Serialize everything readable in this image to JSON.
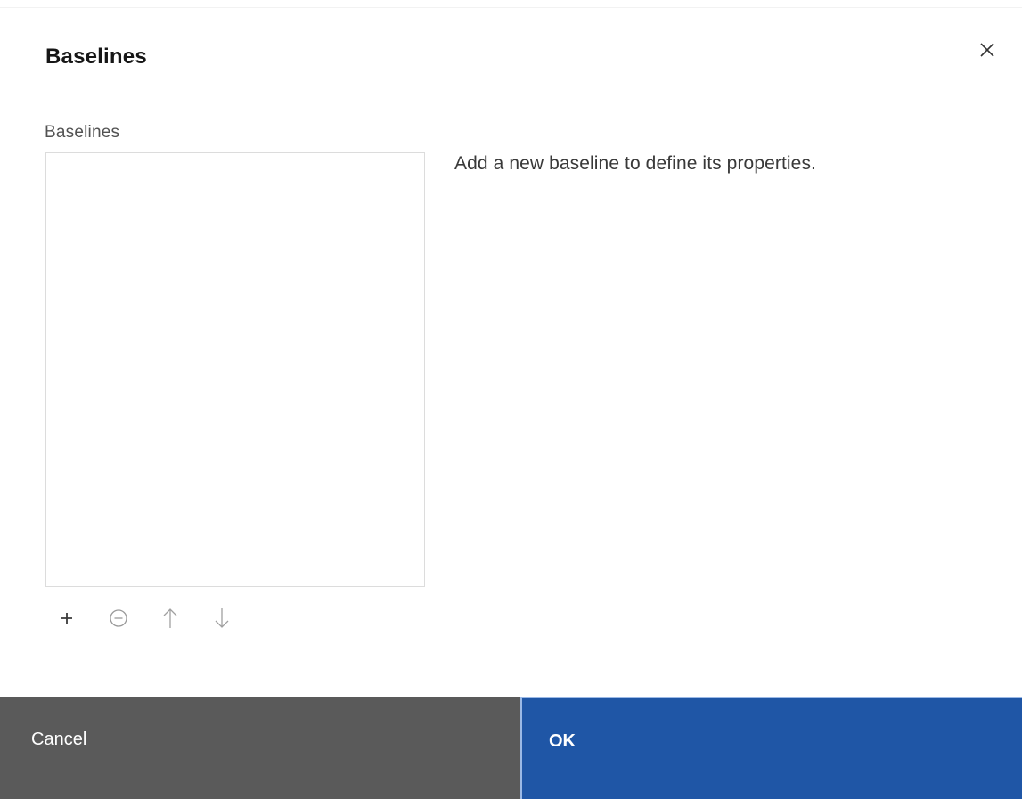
{
  "dialog": {
    "title": "Baselines",
    "close_icon": "close-icon"
  },
  "list": {
    "label": "Baselines",
    "items": [],
    "toolbar": {
      "add_icon": "plus-icon",
      "remove_icon": "minus-circle-icon",
      "move_up_icon": "arrow-up-icon",
      "move_down_icon": "arrow-down-icon"
    }
  },
  "details": {
    "hint": "Add a new baseline to define its properties."
  },
  "footer": {
    "cancel_label": "Cancel",
    "ok_label": "OK"
  },
  "colors": {
    "cancel_bg": "#5a5a5a",
    "ok_bg": "#1f56a6"
  }
}
